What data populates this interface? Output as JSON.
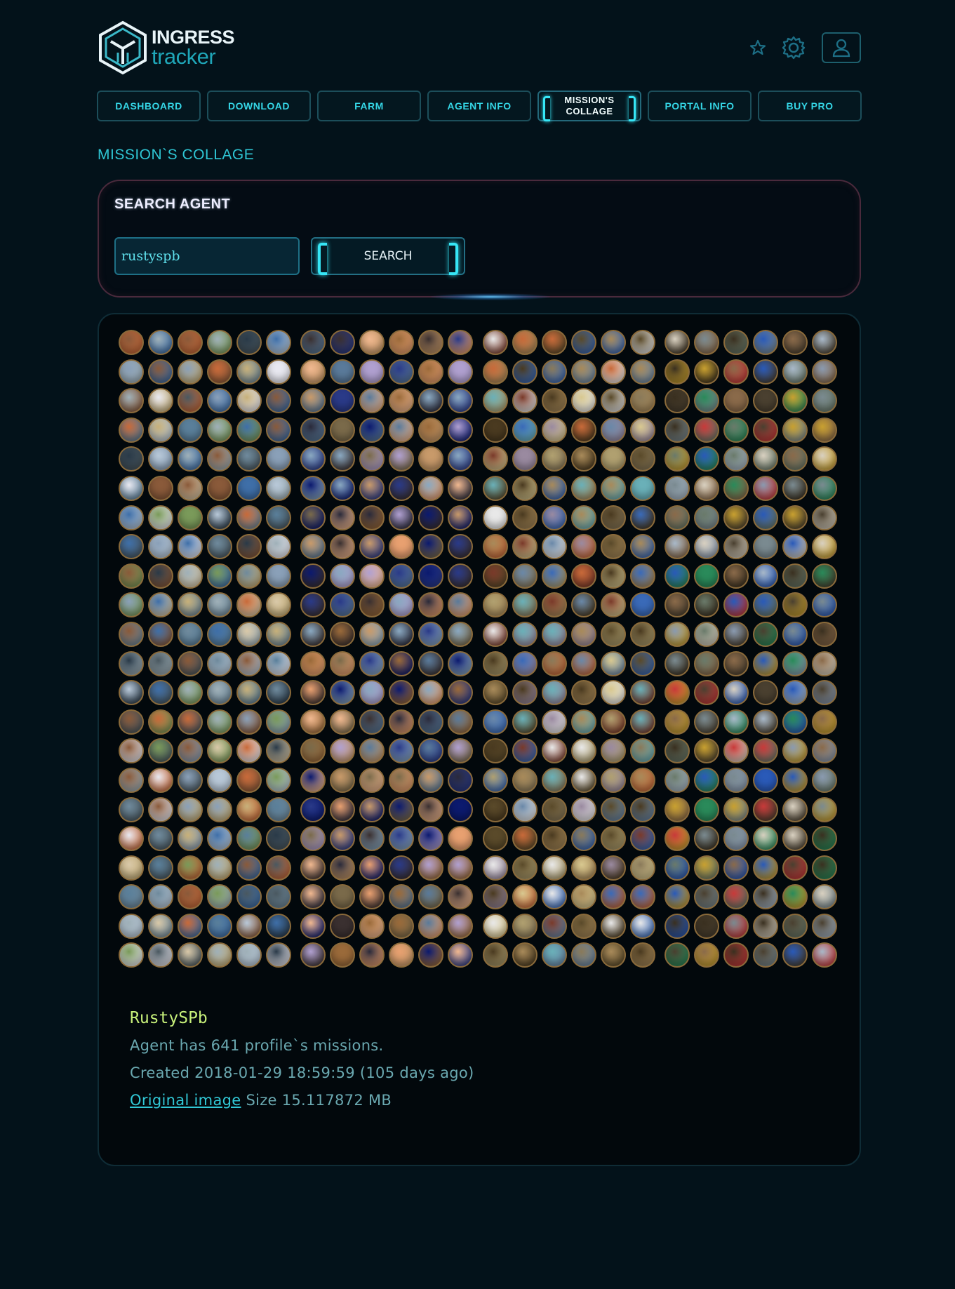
{
  "header": {
    "logo_line1": "INGRESS",
    "logo_line2": "tracker",
    "icons": [
      "star-icon",
      "gear-icon",
      "user-icon"
    ]
  },
  "nav": [
    {
      "label": "DASHBOARD",
      "active": false
    },
    {
      "label": "DOWNLOAD",
      "active": false
    },
    {
      "label": "FARM",
      "active": false
    },
    {
      "label": "AGENT INFO",
      "active": false
    },
    {
      "label": "MISSION'S COLLAGE",
      "active": true
    },
    {
      "label": "PORTAL INFO",
      "active": false
    },
    {
      "label": "BUY PRO",
      "active": false
    }
  ],
  "page_title": "MISSION`S COLLAGE",
  "search": {
    "heading": "SEARCH AGENT",
    "value": "rustyspb",
    "button_label": "SEARCH"
  },
  "collage": {
    "columns": 4,
    "rows": 22,
    "medals_per_row": 6
  },
  "info": {
    "agent_name": "RustySPb",
    "missions_line": "Agent has 641 profile`s missions.",
    "created_line": "Created 2018-01-29 18:59:59 (105 days ago)",
    "link_label": "Original image",
    "size_line": " Size 15.117872 MB"
  },
  "colors": {
    "background": "#03121a",
    "accent": "#36e6f6",
    "title": "#2fc6d4",
    "agent_name": "#c7f07a"
  }
}
